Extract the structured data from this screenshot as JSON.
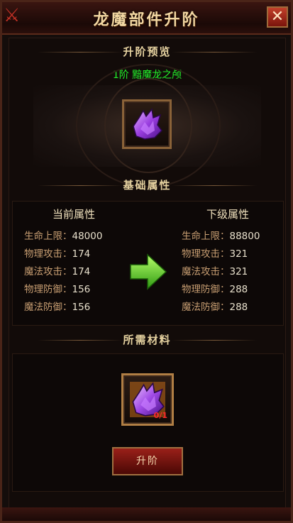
{
  "window": {
    "title": "龙魔部件升阶",
    "close_symbol": "✕"
  },
  "preview": {
    "section_title": "升阶预览",
    "stage_name": "1阶 黯魔龙之颅",
    "item_icon": "purple-dragon-skull-icon"
  },
  "stats": {
    "section_title": "基础属性",
    "current_title": "当前属性",
    "next_title": "下级属性",
    "current": [
      {
        "label": "生命上限：",
        "value": "48000"
      },
      {
        "label": "物理攻击：",
        "value": "174"
      },
      {
        "label": "魔法攻击：",
        "value": "174"
      },
      {
        "label": "物理防御：",
        "value": "156"
      },
      {
        "label": "魔法防御：",
        "value": "156"
      }
    ],
    "next": [
      {
        "label": "生命上限：",
        "value": "88800"
      },
      {
        "label": "物理攻击：",
        "value": "321"
      },
      {
        "label": "魔法攻击：",
        "value": "321"
      },
      {
        "label": "物理防御：",
        "value": "288"
      },
      {
        "label": "魔法防御：",
        "value": "288"
      }
    ]
  },
  "materials": {
    "section_title": "所需材料",
    "item_icon": "purple-dragon-skull-icon",
    "count_badge": "0/1"
  },
  "actions": {
    "upgrade_label": "升阶"
  },
  "colors": {
    "stage_name": "#22f22a",
    "stat_label": "#c89e72",
    "button_red": "#9a2019"
  }
}
